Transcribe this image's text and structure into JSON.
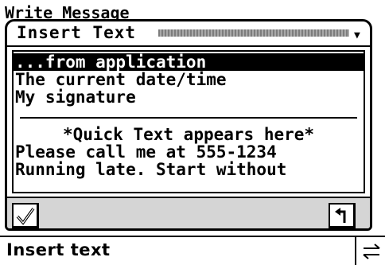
{
  "background_window": {
    "title": "Write Message"
  },
  "dialog": {
    "title": "Insert Text",
    "items": [
      {
        "label": "...from application",
        "selected": true
      },
      {
        "label": "The current date/time",
        "selected": false
      },
      {
        "label": "My signature",
        "selected": false
      }
    ],
    "quick_text_header": "*Quick Text appears here*",
    "quick_texts": [
      {
        "label": "Please call me at 555-1234"
      },
      {
        "label": "Running late. Start without"
      }
    ],
    "menu_arrow": "▼",
    "ok_icon": "checkmark-icon",
    "back_icon": "return-arrow-icon"
  },
  "status_bar": {
    "text": "Insert text",
    "arrows_icon": "left-right-arrows-icon"
  }
}
